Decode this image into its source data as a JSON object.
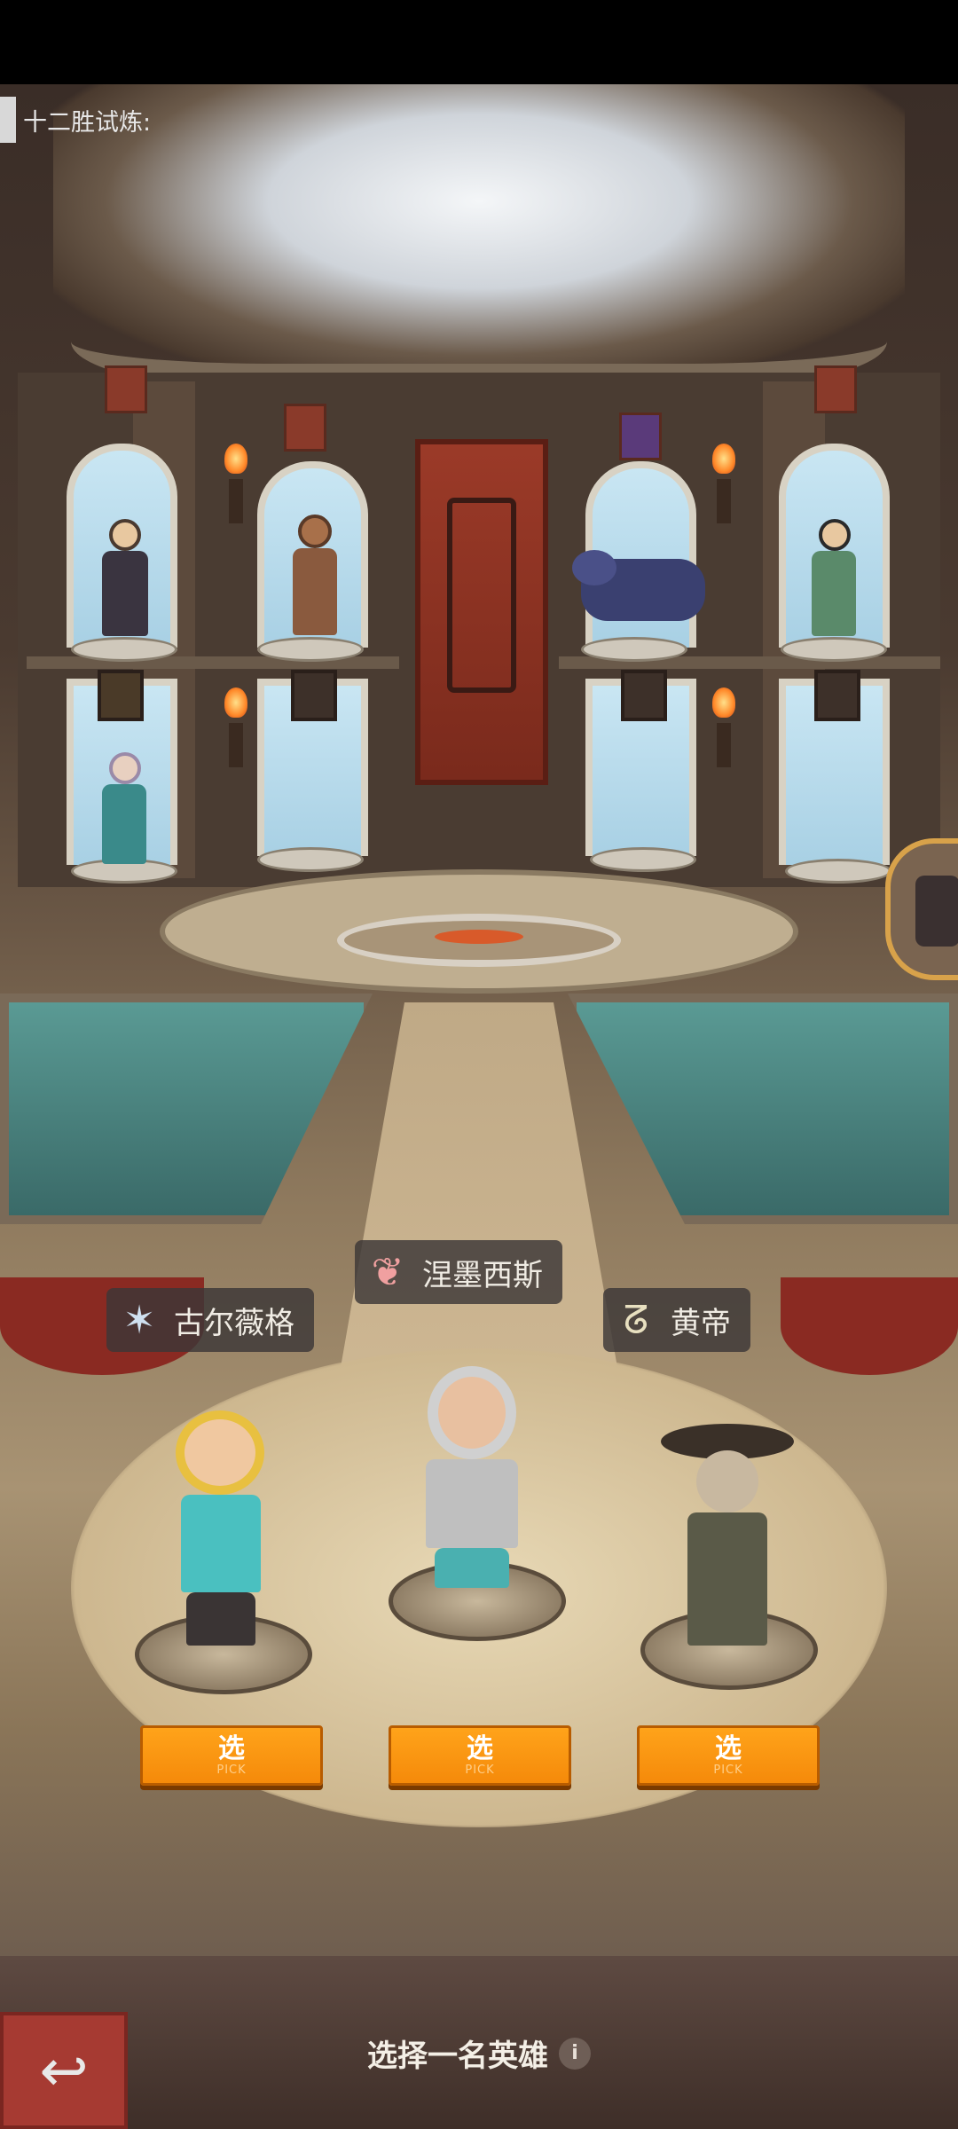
{
  "header": {
    "title": "十二胜试炼:"
  },
  "heroes": [
    {
      "name": "古尔薇格",
      "faction_icon": "wolf-icon",
      "pick_label": "选",
      "pick_sub": "PICK"
    },
    {
      "name": "涅墨西斯",
      "faction_icon": "crest-icon",
      "pick_label": "选",
      "pick_sub": "PICK"
    },
    {
      "name": "黄帝",
      "faction_icon": "dragon-icon",
      "pick_label": "选",
      "pick_sub": "PICK"
    }
  ],
  "footer": {
    "prompt": "选择一名英雄",
    "info_glyph": "i",
    "back_glyph": "↩"
  },
  "colors": {
    "pick_button": "#f79412",
    "back_button": "#a63a32",
    "name_tag_bg": "#3c3737"
  }
}
